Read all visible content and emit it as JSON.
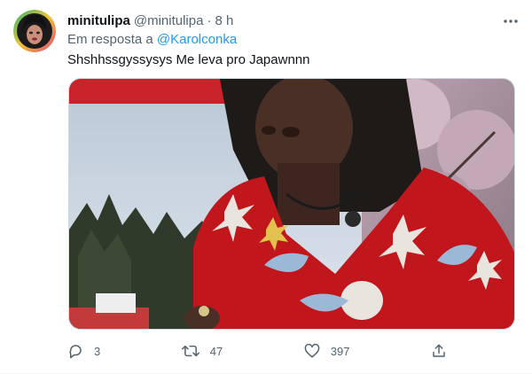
{
  "tweet": {
    "display_name": "minitulipa",
    "handle": "@minitulipa",
    "separator": "·",
    "time": "8 h",
    "reply_prefix": "Em resposta a",
    "reply_to": "@Karolconka",
    "text": "Shshhssgyssysys Me leva pro Japawnnn"
  },
  "actions": {
    "replies": "3",
    "retweets": "47",
    "likes": "397"
  },
  "icons": {
    "more": "more-dots-icon",
    "reply": "reply-icon",
    "retweet": "retweet-icon",
    "like": "heart-icon",
    "share": "share-icon"
  },
  "colors": {
    "link": "#1d9bf0",
    "secondary": "#536471",
    "kimono": "#c0161c"
  }
}
